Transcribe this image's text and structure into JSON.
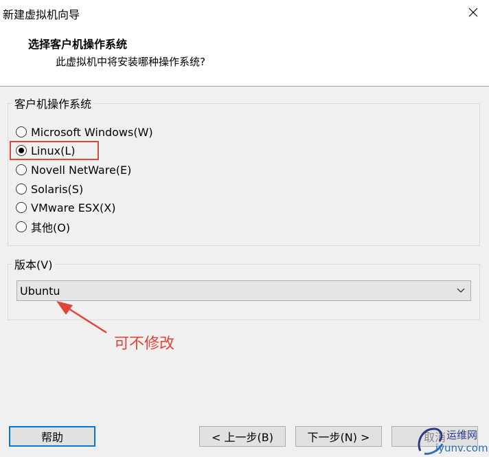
{
  "window": {
    "title": "新建虚拟机向导",
    "close_icon": "close-icon"
  },
  "header": {
    "title": "选择客户机操作系统",
    "subtitle": "此虚拟机中将安装哪种操作系统?"
  },
  "os_group": {
    "legend": "客户机操作系统",
    "options": [
      {
        "label": "Microsoft Windows(W)",
        "selected": false
      },
      {
        "label": "Linux(L)",
        "selected": true
      },
      {
        "label": "Novell NetWare(E)",
        "selected": false
      },
      {
        "label": "Solaris(S)",
        "selected": false
      },
      {
        "label": "VMware ESX(X)",
        "selected": false
      },
      {
        "label": "其他(O)",
        "selected": false
      }
    ]
  },
  "version_group": {
    "legend": "版本(V)",
    "selected": "Ubuntu"
  },
  "annotation": {
    "text": "可不修改",
    "color": "#e0453b"
  },
  "buttons": {
    "help": "帮助",
    "back": "< 上一步(B)",
    "next": "下一步(N) >",
    "cancel": "取消"
  },
  "watermark": {
    "line1": "运维网",
    "line2": "iyunv.com"
  }
}
